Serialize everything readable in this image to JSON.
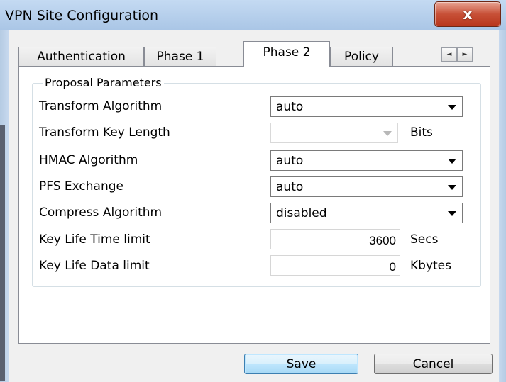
{
  "window": {
    "title": "VPN Site Configuration",
    "close_glyph": "x"
  },
  "tabs": [
    {
      "label": "Authentication",
      "active": false
    },
    {
      "label": "Phase 1",
      "active": false
    },
    {
      "label": "Phase 2",
      "active": true
    },
    {
      "label": "Policy",
      "active": false
    }
  ],
  "tab_scroll": {
    "left_glyph": "◄",
    "right_glyph": "►"
  },
  "group": {
    "title": "Proposal Parameters",
    "fields": {
      "transform_algorithm": {
        "label": "Transform Algorithm",
        "value": "auto"
      },
      "transform_key_length": {
        "label": "Transform Key Length",
        "value": "",
        "unit": "Bits",
        "disabled": true
      },
      "hmac_algorithm": {
        "label": "HMAC Algorithm",
        "value": "auto"
      },
      "pfs_exchange": {
        "label": "PFS Exchange",
        "value": "auto"
      },
      "compress_algorithm": {
        "label": "Compress Algorithm",
        "value": "disabled"
      },
      "key_life_time_limit": {
        "label": "Key Life Time limit",
        "value": "3600",
        "unit": "Secs"
      },
      "key_life_data_limit": {
        "label": "Key Life Data limit",
        "value": "0",
        "unit": "Kbytes"
      }
    }
  },
  "buttons": {
    "save": "Save",
    "cancel": "Cancel"
  },
  "colors": {
    "title_bar": "#b9d1ea",
    "close_button": "#c75037",
    "default_button_border": "#3c7fb1"
  }
}
